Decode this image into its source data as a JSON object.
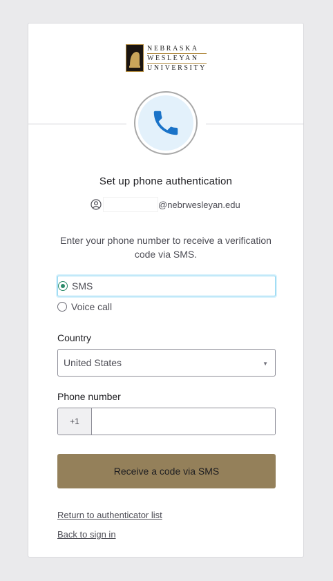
{
  "logo": {
    "line1": "NEBRASKA",
    "line2": "WESLEYAN",
    "line3": "UNIVERSITY"
  },
  "header": {
    "title": "Set up phone authentication"
  },
  "identity": {
    "email_domain": "@nebrwesleyan.edu"
  },
  "instructions": "Enter your phone number to receive a verification code via SMS.",
  "method_options": [
    {
      "label": "SMS",
      "selected": true
    },
    {
      "label": "Voice call",
      "selected": false
    }
  ],
  "country": {
    "label": "Country",
    "value": "United States"
  },
  "phone": {
    "label": "Phone number",
    "prefix": "+1",
    "value": ""
  },
  "submit_label": "Receive a code via SMS",
  "links": {
    "return": "Return to authenticator list",
    "back": "Back to sign in"
  },
  "colors": {
    "accent": "#94805a",
    "phone_icon": "#1a73c8",
    "radio_selected": "#2c8c6a"
  }
}
